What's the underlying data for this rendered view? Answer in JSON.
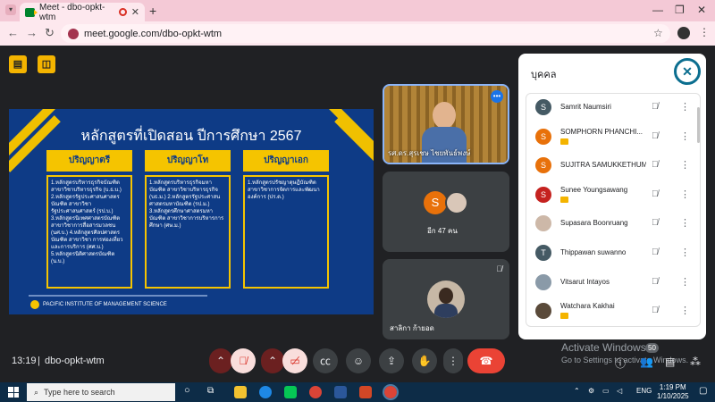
{
  "browser": {
    "tab_title": "Meet - dbo-opkt-wtm",
    "url": "meet.google.com/dbo-opkt-wtm"
  },
  "slide": {
    "title": "หลักสูตรที่เปิดสอน ปีการศึกษา 2567",
    "columns": [
      {
        "head": "ปริญญาตรี",
        "body": "1.หลักสูตรบริหารธุรกิจบัณฑิต สาขาวิชาบริหารธุรกิจ (บ.ธ.บ.) 2.หลักสูตรรัฐประศาสนศาสตรบัณฑิต สาขาวิชารัฐประศาสนศาสตร์ (รป.บ.) 3.หลักสูตรนิเทศศาสตรบัณฑิต สาขาวิชาการสื่อสารมวลชน (นศ.บ.) 4.หลักสูตรศิลปศาสตรบัณฑิต สาขาวิชา การท่องเที่ยวและการบริการ (ศศ.บ.) 5.หลักสูตรนิติศาสตรบัณฑิต (น.บ.)"
      },
      {
        "head": "ปริญญาโท",
        "body": "1.หลักสูตรบริหารธุรกิจมหาบัณฑิต สาขาวิชาบริหารธุรกิจ (บธ.ม.) 2.หลักสูตรรัฐประศาสนศาสตรมหาบัณฑิต (รป.ม.) 3.หลักสูตรศึกษาศาสตรมหาบัณฑิต สาขาวิชาการบริหารการศึกษา (ศษ.ม.)"
      },
      {
        "head": "ปริญญาเอก",
        "body": "1.หลักสูตรปรัชญาดุษฎีบัณฑิต สาขาวิชาการจัดการและพัฒนาองค์การ (ปร.ด.)"
      }
    ],
    "footer": "PACIFIC INSTITUTE OF MANAGEMENT SCIENCE"
  },
  "tiles": {
    "presenter_name": "รศ.ดร.สุรเชษ ไชยพันธ์พงษ์",
    "others_label": "อีก 47 คน",
    "others_initial": "S",
    "participant_name": "สาลิกา ก้ายอด"
  },
  "panel": {
    "title": "บุคคล",
    "people": [
      {
        "name": "Samrit Naumsiri",
        "initial": "S",
        "color": "#455a64",
        "badge": false
      },
      {
        "name": "SOMPHORN PHANCHI...",
        "initial": "S",
        "color": "#e8710a",
        "badge": true
      },
      {
        "name": "SUJITRA SAMUKKETHUM",
        "initial": "S",
        "color": "#e8710a",
        "badge": false
      },
      {
        "name": "Sunee Youngsawang",
        "initial": "S",
        "color": "#c5221f",
        "badge": true
      },
      {
        "name": "Supasara Boonruang",
        "initial": "",
        "color": "#cdb8a8",
        "badge": false
      },
      {
        "name": "Thippawan suwanno",
        "initial": "T",
        "color": "#455a64",
        "badge": false
      },
      {
        "name": "Vitsarut Intayos",
        "initial": "",
        "color": "#8a9aa8",
        "badge": false
      },
      {
        "name": "Watchara Kakhai",
        "initial": "",
        "color": "#5a4a3a",
        "badge": true
      }
    ]
  },
  "controls": {
    "time": "13:19",
    "separator": "|",
    "meeting_code": "dbo-opkt-wtm"
  },
  "watermark": {
    "line1": "Activate Windows",
    "line2": "Go to Settings to activate Windows.",
    "badge": "50"
  },
  "taskbar": {
    "search_placeholder": "Type here to search",
    "lang": "ENG",
    "time": "1:19 PM",
    "date": "1/10/2025"
  }
}
